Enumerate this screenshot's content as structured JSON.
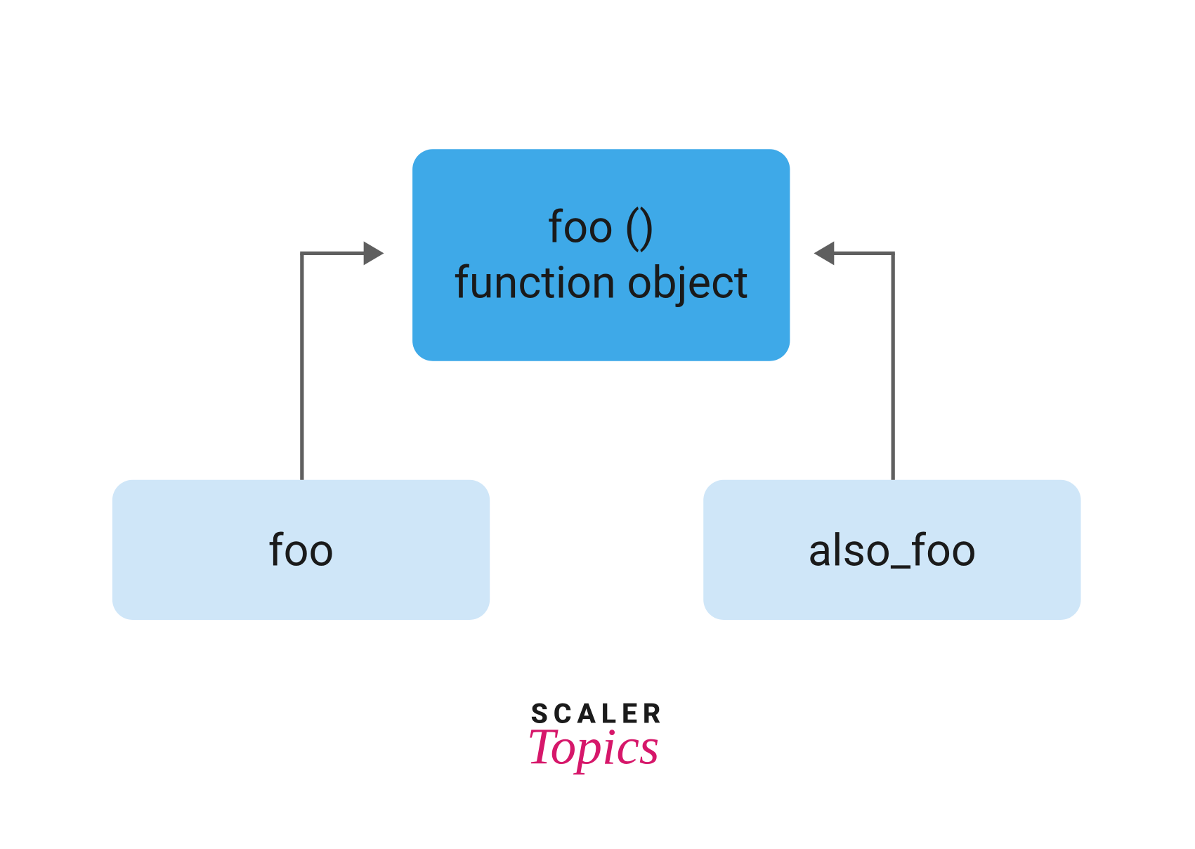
{
  "diagram": {
    "top_node": {
      "line1": "foo ()",
      "line2": "function object"
    },
    "left_node": "foo",
    "right_node": "also_foo"
  },
  "branding": {
    "line1": "SCALER",
    "line2": "Topics"
  },
  "colors": {
    "top_box_bg": "#3ea9e8",
    "bottom_box_bg": "#cfe6f8",
    "arrow": "#5f5f5f",
    "brand_accent": "#d6176a"
  }
}
